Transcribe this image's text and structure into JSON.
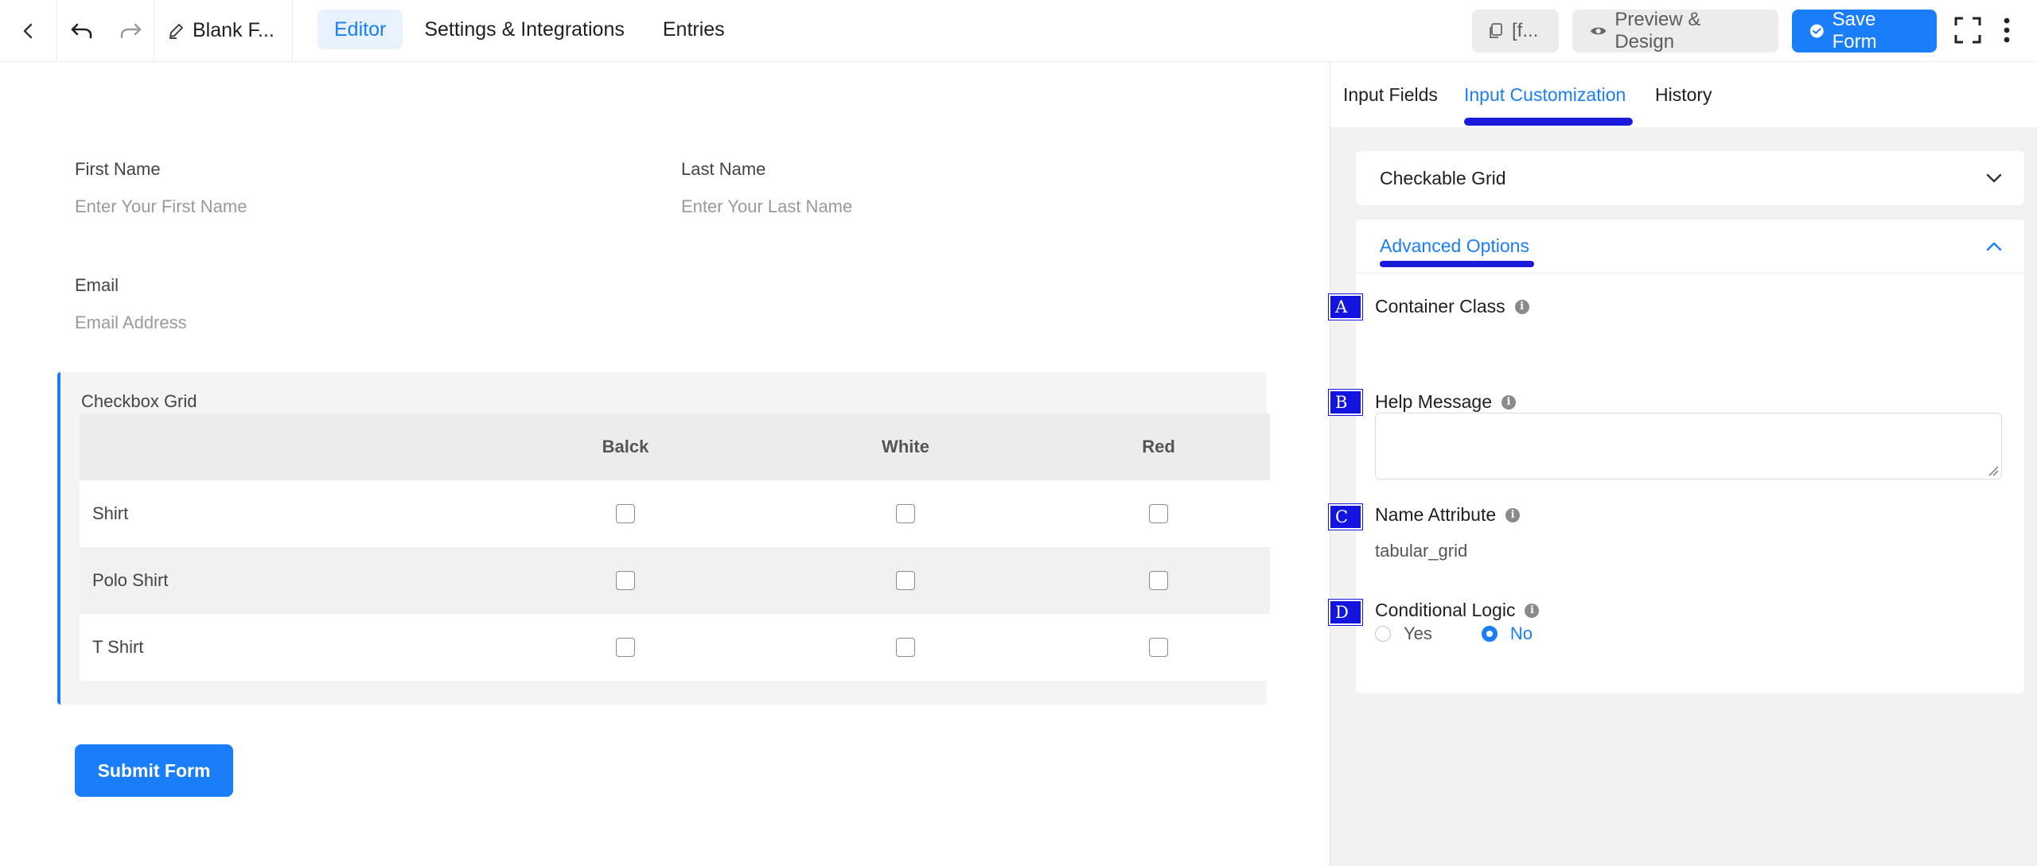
{
  "topbar": {
    "form_title": "Blank F...",
    "tabs": [
      "Editor",
      "Settings & Integrations",
      "Entries"
    ],
    "shortcode_label": "[f...",
    "preview_label": "Preview & Design",
    "save_label": "Save Form",
    "accent": "#1a7efb"
  },
  "form": {
    "first_name": {
      "label": "First Name",
      "placeholder": "Enter Your First Name"
    },
    "last_name": {
      "label": "Last Name",
      "placeholder": "Enter Your Last Name"
    },
    "email": {
      "label": "Email",
      "placeholder": "Email Address"
    },
    "grid": {
      "title": "Checkbox Grid",
      "columns": [
        "Balck",
        "White",
        "Red"
      ],
      "rows": [
        "Shirt",
        "Polo Shirt",
        "T Shirt"
      ]
    },
    "submit_label": "Submit Form"
  },
  "panel": {
    "tabs": [
      "Input Fields",
      "Input Customization",
      "History"
    ],
    "active_tab": "Input Customization",
    "section_checkable": "Checkable Grid",
    "section_advanced": "Advanced Options",
    "options": {
      "container_class": {
        "marker": "A",
        "label": "Container Class"
      },
      "help_message": {
        "marker": "B",
        "label": "Help Message"
      },
      "name_attribute": {
        "marker": "C",
        "label": "Name Attribute",
        "value": "tabular_grid"
      },
      "conditional_logic": {
        "marker": "D",
        "label": "Conditional Logic",
        "yes": "Yes",
        "no": "No",
        "selected": "No"
      }
    },
    "annotation_color": "#1414e0"
  }
}
